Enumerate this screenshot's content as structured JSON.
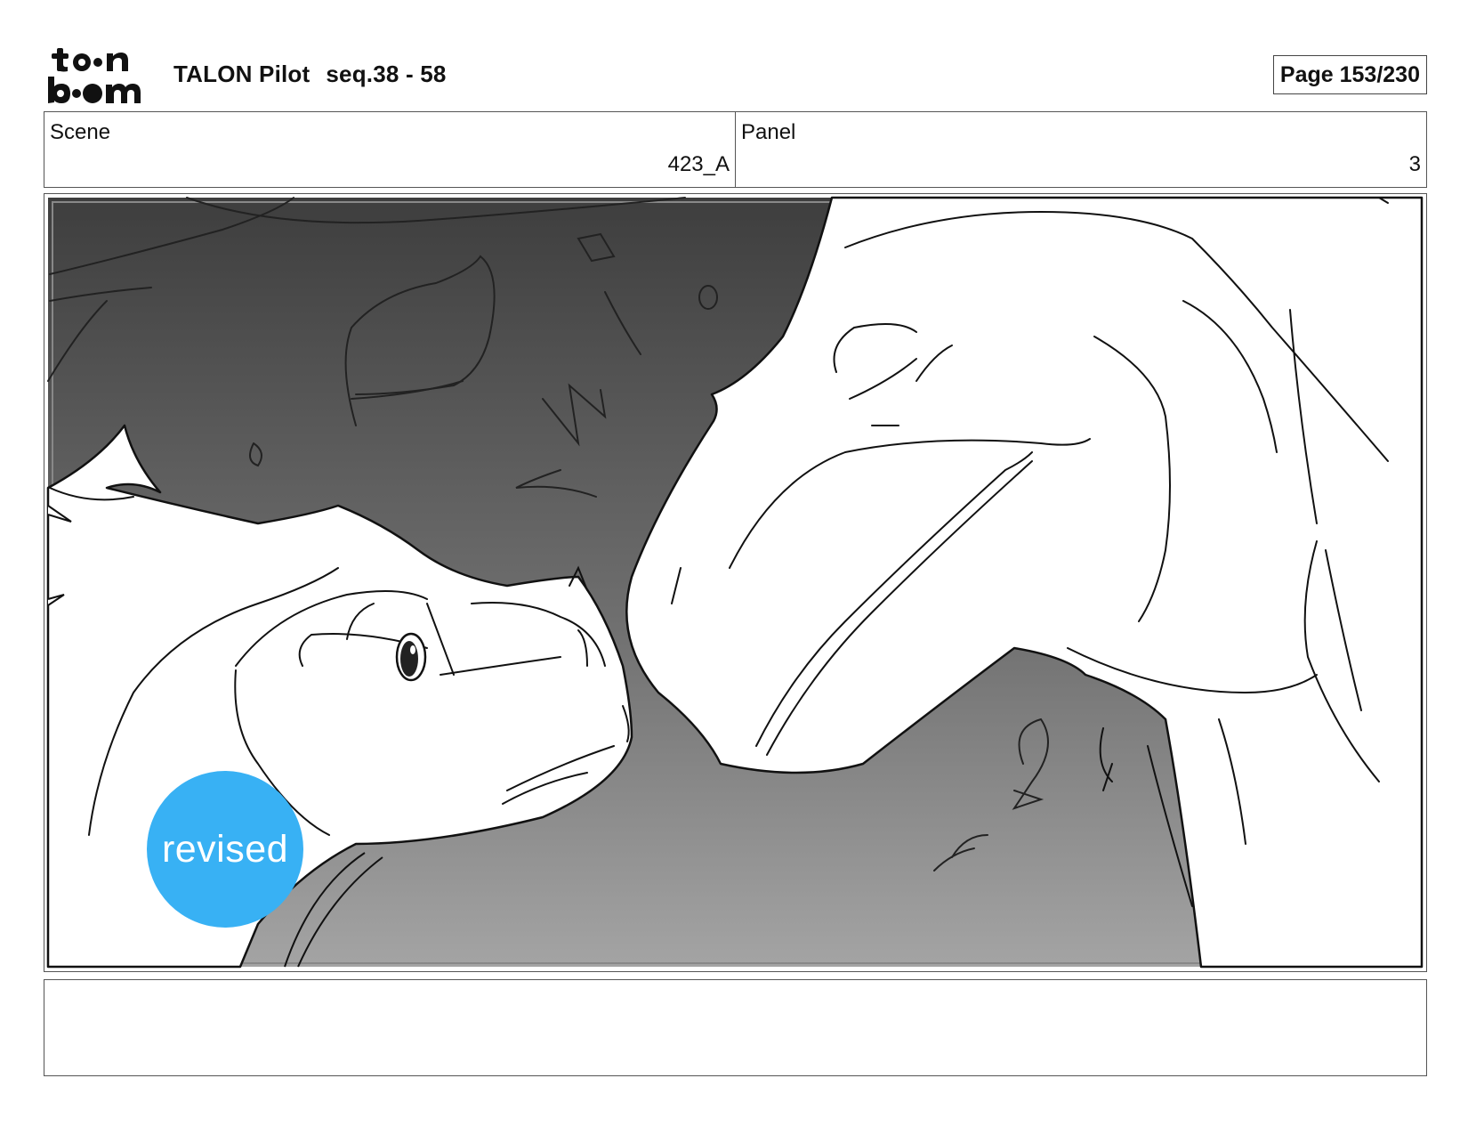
{
  "header": {
    "logo_text_top": "toon",
    "logo_text_bottom": "boom",
    "project_title": "TALON Pilot",
    "sequence": "seq.38 - 58",
    "page_label": "Page 153/230"
  },
  "info": {
    "scene_label": "Scene",
    "scene_value": "423_A",
    "panel_label": "Panel",
    "panel_value": "3"
  },
  "panel": {
    "badge_text": "revised",
    "badge_color": "#38b1f4",
    "description": ""
  },
  "icons": [
    "toon-boom-logo-icon",
    "revised-badge"
  ]
}
